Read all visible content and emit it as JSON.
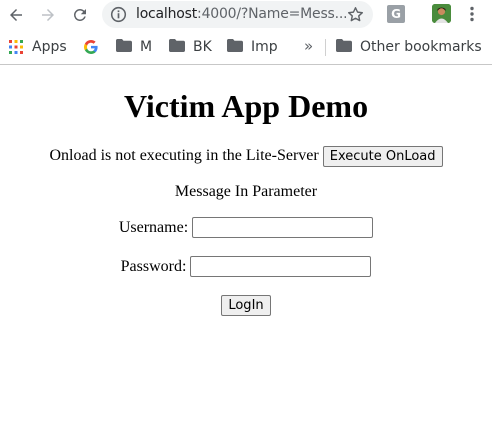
{
  "browser": {
    "url_host": "localhost",
    "url_rest": ":4000/?Name=Mess...",
    "extension_label": "G"
  },
  "bookmarks": {
    "items": [
      {
        "label": "Apps"
      },
      {
        "label": ""
      },
      {
        "label": "M"
      },
      {
        "label": "BK"
      },
      {
        "label": "Imp"
      }
    ],
    "overflow": "»",
    "other": "Other bookmarks"
  },
  "page": {
    "title": "Victim App Demo",
    "onload_text": "Onload is not executing in the Lite-Server",
    "onload_button": "Execute OnLoad",
    "message": "Message In Parameter",
    "username_label": "Username:",
    "username_value": "",
    "password_label": "Password:",
    "password_value": "",
    "login_button": "LogIn"
  },
  "colors": {
    "toolbar_bg": "#ffffff",
    "omnibox_bg": "#f1f3f4",
    "icon_gray": "#5f6368",
    "folder_gray": "#5f6368"
  }
}
